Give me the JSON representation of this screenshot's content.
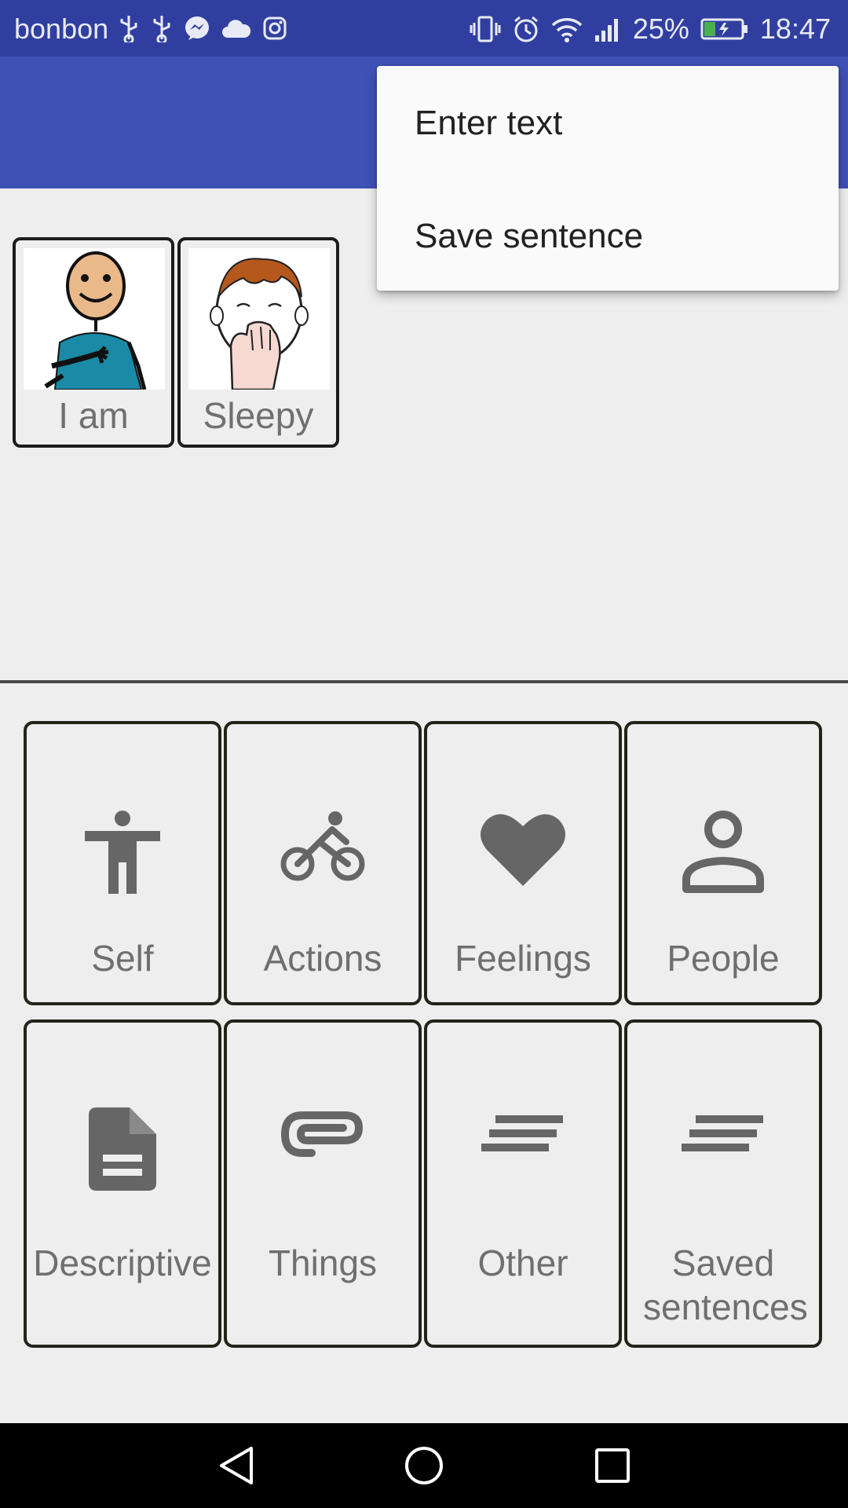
{
  "status_bar": {
    "carrier": "bonbon",
    "left_icons": [
      "usb-icon",
      "usb-icon",
      "messenger-icon",
      "cloud-icon",
      "instagram-icon"
    ],
    "right_icons": [
      "vibrate-icon",
      "alarm-icon",
      "wifi-icon",
      "signal-icon",
      "battery-charging-icon"
    ],
    "battery": "25%",
    "time": "18:47",
    "background": "#303f9f"
  },
  "app_bar": {
    "color": "#3f51b5"
  },
  "overflow_menu": {
    "items": [
      {
        "label": "Enter text"
      },
      {
        "label": "Save sentence"
      }
    ]
  },
  "sentence": {
    "words": [
      {
        "label": "I am",
        "picture": "person-pointing-to-self"
      },
      {
        "label": "Sleepy",
        "picture": "yawning-boy"
      }
    ]
  },
  "categories": [
    {
      "label": "Self",
      "icon": "accessibility-icon"
    },
    {
      "label": "Actions",
      "icon": "bike-icon"
    },
    {
      "label": "Feelings",
      "icon": "heart-icon"
    },
    {
      "label": "People",
      "icon": "person-outline-icon"
    },
    {
      "label": "Descriptive",
      "icon": "document-icon"
    },
    {
      "label": "Things",
      "icon": "paperclip-icon"
    },
    {
      "label": "Other",
      "icon": "short-text-icon"
    },
    {
      "label": "Saved sentences",
      "icon": "short-text-icon"
    }
  ],
  "nav_bar": {
    "buttons": [
      "back-icon",
      "home-icon",
      "recents-icon"
    ]
  }
}
